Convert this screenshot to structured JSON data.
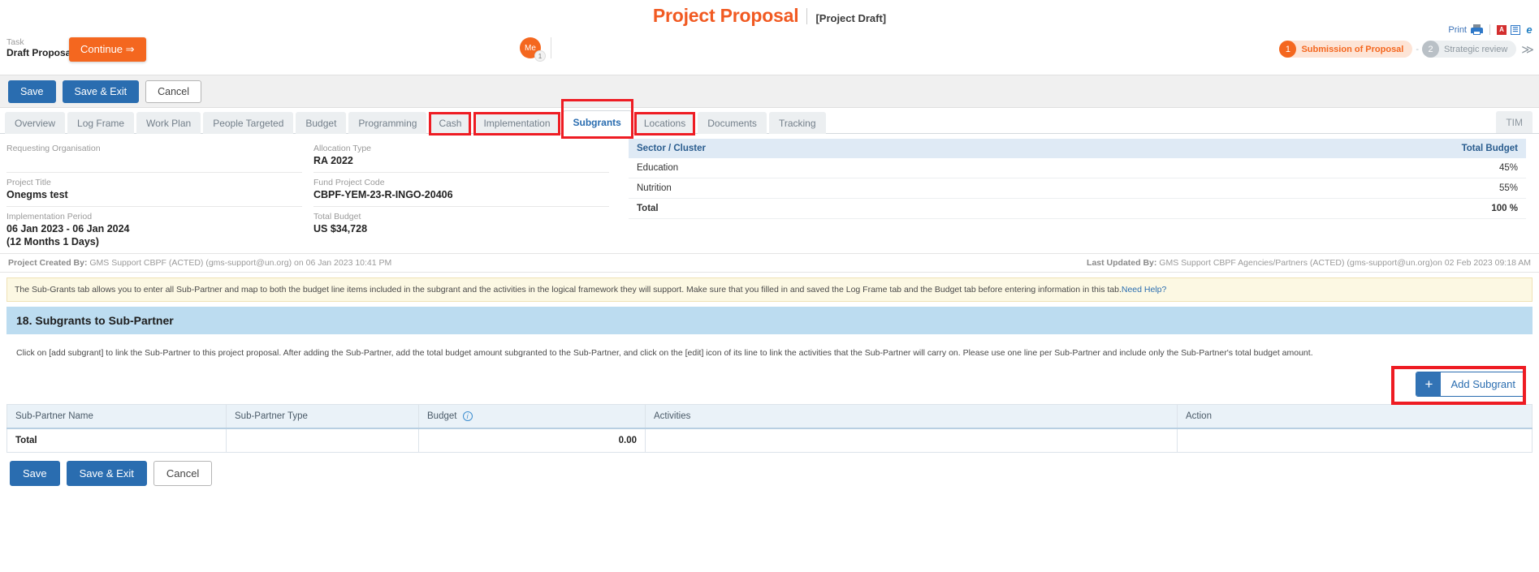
{
  "header": {
    "title": "Project Proposal",
    "subtitle": "[Project Draft]",
    "task_label": "Task",
    "task_value": "Draft Proposal",
    "continue_label": "Continue ⇒",
    "me_label": "Me",
    "me_count": "1",
    "print_label": "Print",
    "icons": {
      "print": "printer-icon",
      "pdf": "A",
      "excel": "☰",
      "ie": "e"
    }
  },
  "workflow": {
    "steps": [
      {
        "num": "1",
        "label": "Submission of Proposal",
        "active": true
      },
      {
        "num": "2",
        "label": "Strategic review",
        "active": false
      }
    ],
    "separator": "-",
    "more": "≫"
  },
  "toolbar": {
    "save_label": "Save",
    "save_exit_label": "Save & Exit",
    "cancel_label": "Cancel"
  },
  "tabs": {
    "items": [
      {
        "label": "Overview",
        "active": false
      },
      {
        "label": "Log Frame",
        "active": false
      },
      {
        "label": "Work Plan",
        "active": false
      },
      {
        "label": "People Targeted",
        "active": false
      },
      {
        "label": "Budget",
        "active": false
      },
      {
        "label": "Programming",
        "active": false
      },
      {
        "label": "Cash",
        "active": false
      },
      {
        "label": "Implementation",
        "active": false
      },
      {
        "label": "Subgrants",
        "active": true
      },
      {
        "label": "Locations",
        "active": false
      },
      {
        "label": "Documents",
        "active": false
      },
      {
        "label": "Tracking",
        "active": false
      }
    ],
    "right_label": "TIM"
  },
  "project": {
    "left": [
      {
        "label": "Requesting Organisation",
        "value": ""
      },
      {
        "label": "Project Title",
        "value": "Onegms test"
      },
      {
        "label": "Implementation Period",
        "value": "06 Jan 2023 - 06 Jan 2024\n(12 Months 1 Days)"
      }
    ],
    "middle": [
      {
        "label": "Allocation Type",
        "value": "RA 2022"
      },
      {
        "label": "Fund Project Code",
        "value": "CBPF-YEM-23-R-INGO-20406"
      },
      {
        "label": "Total Budget",
        "value": "US $34,728"
      }
    ],
    "implementation_line1": "06 Jan 2023 - 06 Jan 2024",
    "implementation_line2": "(12 Months 1 Days)"
  },
  "sector_table": {
    "columns": [
      "Sector / Cluster",
      "Total Budget"
    ],
    "rows": [
      {
        "sector": "Education",
        "budget": "45%"
      },
      {
        "sector": "Nutrition",
        "budget": "55%"
      }
    ],
    "total": {
      "sector": "Total",
      "budget": "100 %"
    }
  },
  "audit": {
    "created_label": "Project Created By:",
    "created_value": "GMS Support CBPF (ACTED) (gms-support@un.org) on 06 Jan 2023 10:41 PM",
    "updated_label": "Last Updated By:",
    "updated_value": "GMS Support CBPF Agencies/Partners (ACTED) (gms-support@un.org)on 02 Feb 2023 09:18 AM"
  },
  "notice": {
    "text": "The Sub-Grants tab allows you to enter all Sub-Partner and map to both the budget line items included in the subgrant and the activities in the logical framework they will support. Make sure that you filled in and saved the Log Frame tab and the Budget tab before entering information in this tab.",
    "link": "Need Help?"
  },
  "section": {
    "heading": "18. Subgrants to Sub-Partner",
    "description": "Click on [add subgrant] to link the Sub-Partner to this project proposal. After adding the Sub-Partner, add the total budget amount subgranted to the Sub-Partner, and click on the [edit] icon of its line to link the activities that the Sub-Partner will carry on. Please use one line per Sub-Partner and include only the Sub-Partner's total budget amount.",
    "add_button_label": "Add Subgrant",
    "add_button_icon": "plus-icon"
  },
  "subgrants_table": {
    "columns": [
      "Sub-Partner Name",
      "Sub-Partner Type",
      "Budget",
      "Activities",
      "Action"
    ],
    "budget_info_icon": "info-icon",
    "rows": [],
    "total_row": {
      "label": "Total",
      "type": "",
      "budget": "0.00",
      "activities": "",
      "action": ""
    }
  },
  "footer": {
    "save_label": "Save",
    "save_exit_label": "Save & Exit",
    "cancel_label": "Cancel"
  },
  "colors": {
    "brand_orange": "#f15a22",
    "primary_blue": "#2a6db0",
    "highlight_red": "#ee1c23",
    "section_blue": "#bcdcf0",
    "notice_yellow": "#fcf8e3"
  }
}
